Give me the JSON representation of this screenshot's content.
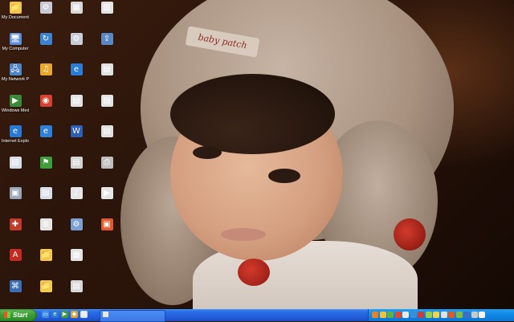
{
  "wallpaper": {
    "hat_label": "baby patch"
  },
  "desktop_icons": [
    {
      "name": "my-documents-icon",
      "label": "My Documents",
      "color": "#f1c64a",
      "glyph": "📁"
    },
    {
      "name": "my-computer-icon",
      "label": "My Computer",
      "color": "#5b8fd8",
      "glyph": "🖥"
    },
    {
      "name": "my-network-places-icon",
      "label": "My Network Places",
      "color": "#4f86c6",
      "glyph": "🖧"
    },
    {
      "name": "windows-media-player-icon",
      "label": "Windows Media Player",
      "color": "#3a8a3a",
      "glyph": "▶"
    },
    {
      "name": "internet-explorer-icon",
      "label": "Internet Explorer",
      "color": "#2a78d6",
      "glyph": "e"
    },
    {
      "name": "document-icon",
      "label": "",
      "color": "#d9dde5",
      "glyph": "▤"
    },
    {
      "name": "application-icon",
      "label": "",
      "color": "#9ba7b8",
      "glyph": "▣"
    },
    {
      "name": "app-icon-red",
      "label": "",
      "color": "#c23a2b",
      "glyph": "✚"
    },
    {
      "name": "acrobat-reader-icon",
      "label": "",
      "color": "#c42b1e",
      "glyph": "A"
    },
    {
      "name": "remote-desktop-icon",
      "label": "",
      "color": "#3b6fb3",
      "glyph": "⌘"
    },
    {
      "name": "control-icon",
      "label": "",
      "color": "#c9c9d6",
      "glyph": "⚙"
    },
    {
      "name": "sync-icon",
      "label": "",
      "color": "#3b82d1",
      "glyph": "↻"
    },
    {
      "name": "winamp-icon",
      "label": "",
      "color": "#e8a92b",
      "glyph": "♫"
    },
    {
      "name": "chrome-icon",
      "label": "",
      "color": "#d7412f",
      "glyph": "◉"
    },
    {
      "name": "ie-icon-2",
      "label": "",
      "color": "#2d7fd8",
      "glyph": "e"
    },
    {
      "name": "flag-icon",
      "label": "",
      "color": "#3f9c3a",
      "glyph": "⚑"
    },
    {
      "name": "doc-icon-2",
      "label": "",
      "color": "#d8dee8",
      "glyph": "▤"
    },
    {
      "name": "text-file-icon",
      "label": "",
      "color": "#e4e4e4",
      "glyph": "≣"
    },
    {
      "name": "folder-icon",
      "label": "",
      "color": "#f2c94c",
      "glyph": "📁"
    },
    {
      "name": "folder-icon-2",
      "label": "",
      "color": "#f2c94c",
      "glyph": "📁"
    },
    {
      "name": "media-icon",
      "label": "",
      "color": "#d9d9d9",
      "glyph": "▦"
    },
    {
      "name": "app-icon-3",
      "label": "",
      "color": "#c8ced8",
      "glyph": "⚙"
    },
    {
      "name": "ie-icon-3",
      "label": "",
      "color": "#2a7dd6",
      "glyph": "e"
    },
    {
      "name": "doc-icon-3",
      "label": "",
      "color": "#e2e2e2",
      "glyph": "▤"
    },
    {
      "name": "word-doc-icon",
      "label": "",
      "color": "#2d5fb6",
      "glyph": "W"
    },
    {
      "name": "app-icon-4",
      "label": "",
      "color": "#d3d3d3",
      "glyph": "▤"
    },
    {
      "name": "media-file-icon",
      "label": "",
      "color": "#e6e6e6",
      "glyph": "♪"
    },
    {
      "name": "setup-icon",
      "label": "",
      "color": "#7aa0d4",
      "glyph": "⚙"
    },
    {
      "name": "spreadsheet-icon",
      "label": "",
      "color": "#e3e3e3",
      "glyph": "▦"
    },
    {
      "name": "app-icon-5",
      "label": "",
      "color": "#d8d8d8",
      "glyph": "▤"
    },
    {
      "name": "pdf-icon",
      "label": "",
      "color": "#e4e4e4",
      "glyph": "▥"
    },
    {
      "name": "shortcut-icon",
      "label": "",
      "color": "#5b87c4",
      "glyph": "⇪"
    },
    {
      "name": "app-icon-6",
      "label": "",
      "color": "#e0e0e0",
      "glyph": "▤"
    },
    {
      "name": "doc-icon-4",
      "label": "",
      "color": "#e3e3e3",
      "glyph": "▤"
    },
    {
      "name": "app-icon-7",
      "label": "",
      "color": "#e0e0e0",
      "glyph": "▤"
    },
    {
      "name": "printer-icon",
      "label": "",
      "color": "#bfbfbf",
      "glyph": "⎙"
    },
    {
      "name": "video-icon",
      "label": "",
      "color": "#e5e5e5",
      "glyph": "▶"
    },
    {
      "name": "presentation-icon",
      "label": "",
      "color": "#e05a2b",
      "glyph": "▣"
    }
  ],
  "taskbar": {
    "start_label": "Start",
    "quick_launch": [
      {
        "name": "show-desktop-icon",
        "color": "#3d8ee0",
        "glyph": "▭"
      },
      {
        "name": "ie-quicklaunch-icon",
        "color": "#2a7ad6",
        "glyph": "e"
      },
      {
        "name": "media-quicklaunch-icon",
        "color": "#3c9c3c",
        "glyph": "▶"
      },
      {
        "name": "app-quicklaunch-icon",
        "color": "#d9a531",
        "glyph": "◆"
      },
      {
        "name": "app-quicklaunch-icon-2",
        "color": "#e0e0e0",
        "glyph": "▤"
      }
    ],
    "task_label": "",
    "lang_text": "",
    "tray_icons": [
      {
        "name": "tray-icon-1",
        "color": "#e8802a"
      },
      {
        "name": "tray-icon-2",
        "color": "#f0c23b"
      },
      {
        "name": "tray-icon-3",
        "color": "#5ab14a"
      },
      {
        "name": "tray-icon-4",
        "color": "#d84a3b"
      },
      {
        "name": "tray-icon-5",
        "color": "#e7e7e7"
      },
      {
        "name": "tray-icon-6",
        "color": "#3a8ed8"
      },
      {
        "name": "tray-icon-7",
        "color": "#c43f3f"
      },
      {
        "name": "tray-icon-8",
        "color": "#9ad04a"
      },
      {
        "name": "tray-icon-9",
        "color": "#f2d24a"
      },
      {
        "name": "tray-icon-10",
        "color": "#e0e0e0"
      },
      {
        "name": "tray-icon-11",
        "color": "#d65a2a"
      },
      {
        "name": "tray-icon-12",
        "color": "#7fbf3f"
      },
      {
        "name": "tray-icon-13",
        "color": "#3b6fc3"
      },
      {
        "name": "tray-icon-14",
        "color": "#c9c9c9"
      },
      {
        "name": "volume-icon",
        "color": "#f4f4f4"
      }
    ],
    "clock": ""
  }
}
